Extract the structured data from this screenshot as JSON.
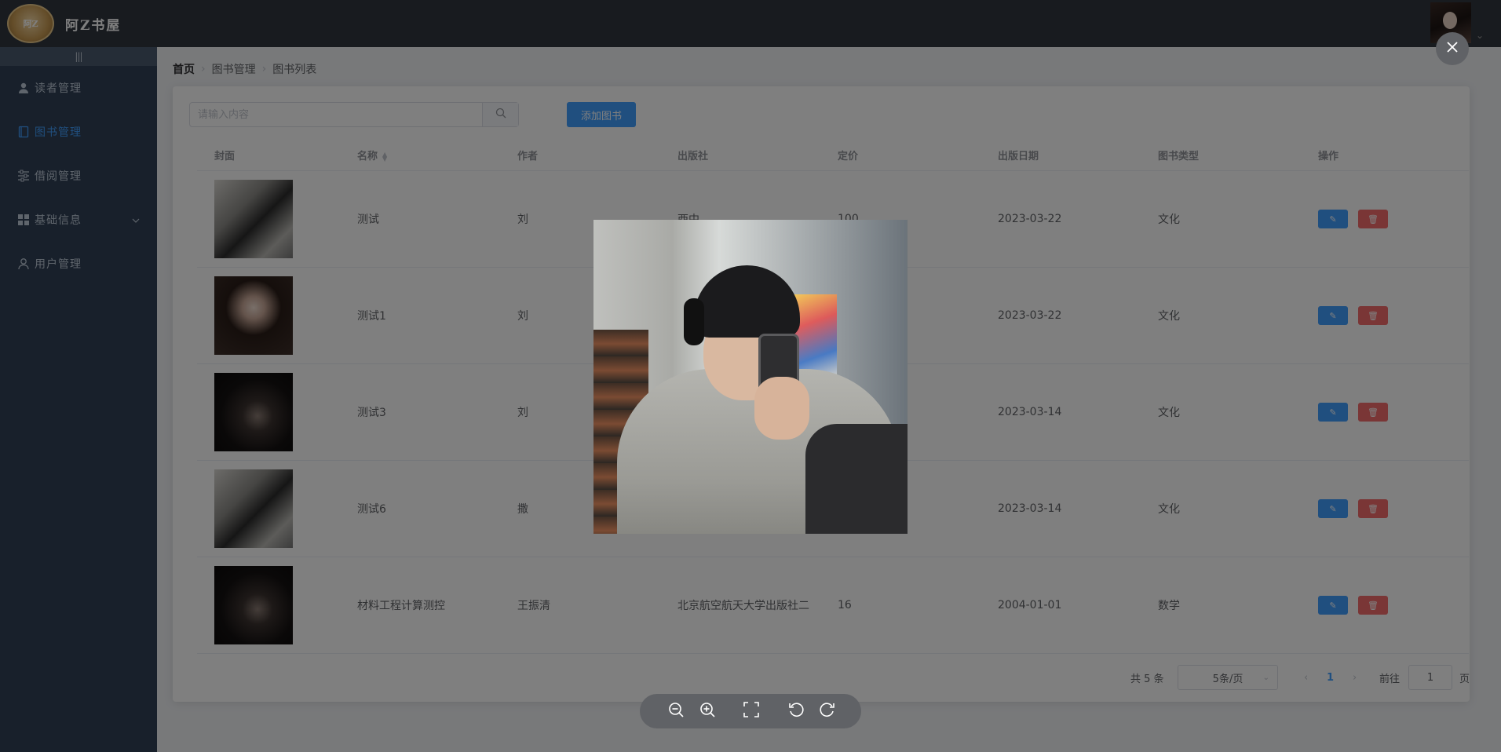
{
  "header": {
    "logo_text": "阿Z",
    "app_title": "阿Z书屋"
  },
  "sidebar": {
    "collapse_label": "|||",
    "items": [
      {
        "label": "读者管理",
        "icon": "user-icon",
        "active": false
      },
      {
        "label": "图书管理",
        "icon": "book-icon",
        "active": true
      },
      {
        "label": "借阅管理",
        "icon": "sliders-icon",
        "active": false
      },
      {
        "label": "基础信息",
        "icon": "grid-icon",
        "active": false,
        "has_submenu": true
      },
      {
        "label": "用户管理",
        "icon": "user-outline-icon",
        "active": false
      }
    ]
  },
  "breadcrumb": [
    "首页",
    "图书管理",
    "图书列表"
  ],
  "search": {
    "placeholder": "请输入内容",
    "value": ""
  },
  "add_button": "添加图书",
  "table": {
    "headers": [
      "封面",
      "名称",
      "作者",
      "出版社",
      "定价",
      "出版日期",
      "图书类型",
      "操作"
    ],
    "rows": [
      {
        "name": "测试",
        "author": "刘",
        "publisher": "西中",
        "price": "100",
        "date": "2023-03-22",
        "type": "文化",
        "cover": "selfie-boy"
      },
      {
        "name": "测试1",
        "author": "刘",
        "publisher": "",
        "price": "",
        "date": "2023-03-22",
        "type": "文化",
        "cover": "portrait-girl"
      },
      {
        "name": "测试3",
        "author": "刘",
        "publisher": "",
        "price": "",
        "date": "2023-03-14",
        "type": "文化",
        "cover": "dark-hand"
      },
      {
        "name": "测试6",
        "author": "撒",
        "publisher": "",
        "price": "",
        "date": "2023-03-14",
        "type": "文化",
        "cover": "selfie-boy"
      },
      {
        "name": "材料工程计算测控",
        "author": "王振清",
        "publisher": "北京航空航天大学出版社二",
        "price": "16",
        "date": "2004-01-01",
        "type": "数学",
        "cover": "dark-hand"
      }
    ]
  },
  "pagination": {
    "total": "共 5 条",
    "page_size": "5条/页",
    "current_page": "1",
    "goto_label": "前往",
    "goto_value": "1",
    "page_suffix": "页"
  },
  "colors": {
    "primary": "#409eff",
    "danger": "#f56c6c",
    "sidebar_bg": "#304156",
    "header_bg": "#30363f"
  }
}
